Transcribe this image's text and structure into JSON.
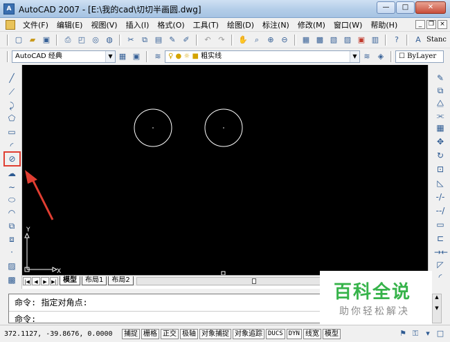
{
  "window": {
    "title": "AutoCAD 2007 - [E:\\我的cad\\切切半画圆.dwg]",
    "controls": {
      "minimize": "—",
      "maximize": "□",
      "close": "✕"
    }
  },
  "menu": {
    "items": [
      "文件(F)",
      "编辑(E)",
      "视图(V)",
      "插入(I)",
      "格式(O)",
      "工具(T)",
      "绘图(D)",
      "标注(N)",
      "修改(M)",
      "窗口(W)",
      "帮助(H)"
    ],
    "mdi": {
      "minimize": "_",
      "restore": "❐",
      "close": "×"
    }
  },
  "toolbar2": {
    "workspace": "AutoCAD 经典",
    "layer": "粗实线",
    "linetype": "ByLayer"
  },
  "toolbar1": {
    "style_text": "Stanc"
  },
  "tabs": [
    "模型",
    "布局1",
    "布局2"
  ],
  "command": {
    "line1": "命令: 指定对角点:",
    "line2": "命令:"
  },
  "status": {
    "coords": "372.1127, -39.8676, 0.0000",
    "toggles": [
      "捕捉",
      "栅格",
      "正交",
      "极轴",
      "对象捕捉",
      "对象追踪",
      "DUCS",
      "DYN",
      "线宽",
      "模型"
    ]
  },
  "ucs": {
    "x": "X",
    "y": "Y"
  },
  "watermark": {
    "title": "百科全说",
    "subtitle": "助你轻松解决"
  },
  "colors": {
    "accent": "#e03e32",
    "watermark": "#36b34a"
  }
}
